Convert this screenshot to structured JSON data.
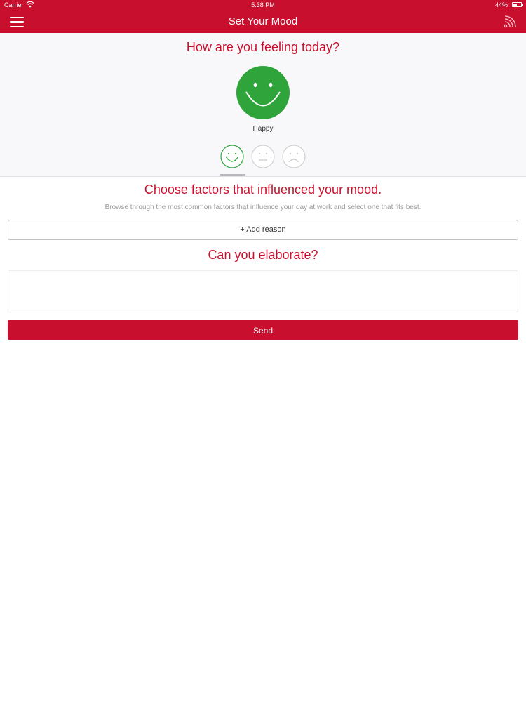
{
  "status_bar": {
    "carrier": "Carrier",
    "time": "5:38 PM",
    "battery": "44%"
  },
  "nav_bar": {
    "title": "Set Your Mood",
    "left_icon": "menu-icon",
    "right_icon": "rss-icon"
  },
  "mood": {
    "question": "How are you feeling today?",
    "selected_label": "Happy",
    "options": [
      "happy",
      "neutral",
      "sad"
    ],
    "selected_index": 0
  },
  "factors": {
    "title": "Choose factors that influenced your mood.",
    "description": "Browse through the most common factors that influence your day at work and select one that fits best.",
    "add_reason_label": "+ Add reason"
  },
  "elaborate": {
    "title": "Can you elaborate?",
    "value": ""
  },
  "send_label": "Send",
  "colors": {
    "brand_red": "#c8102e",
    "happy_green": "#2fa43a",
    "inactive_grey": "#c7c7c7"
  }
}
